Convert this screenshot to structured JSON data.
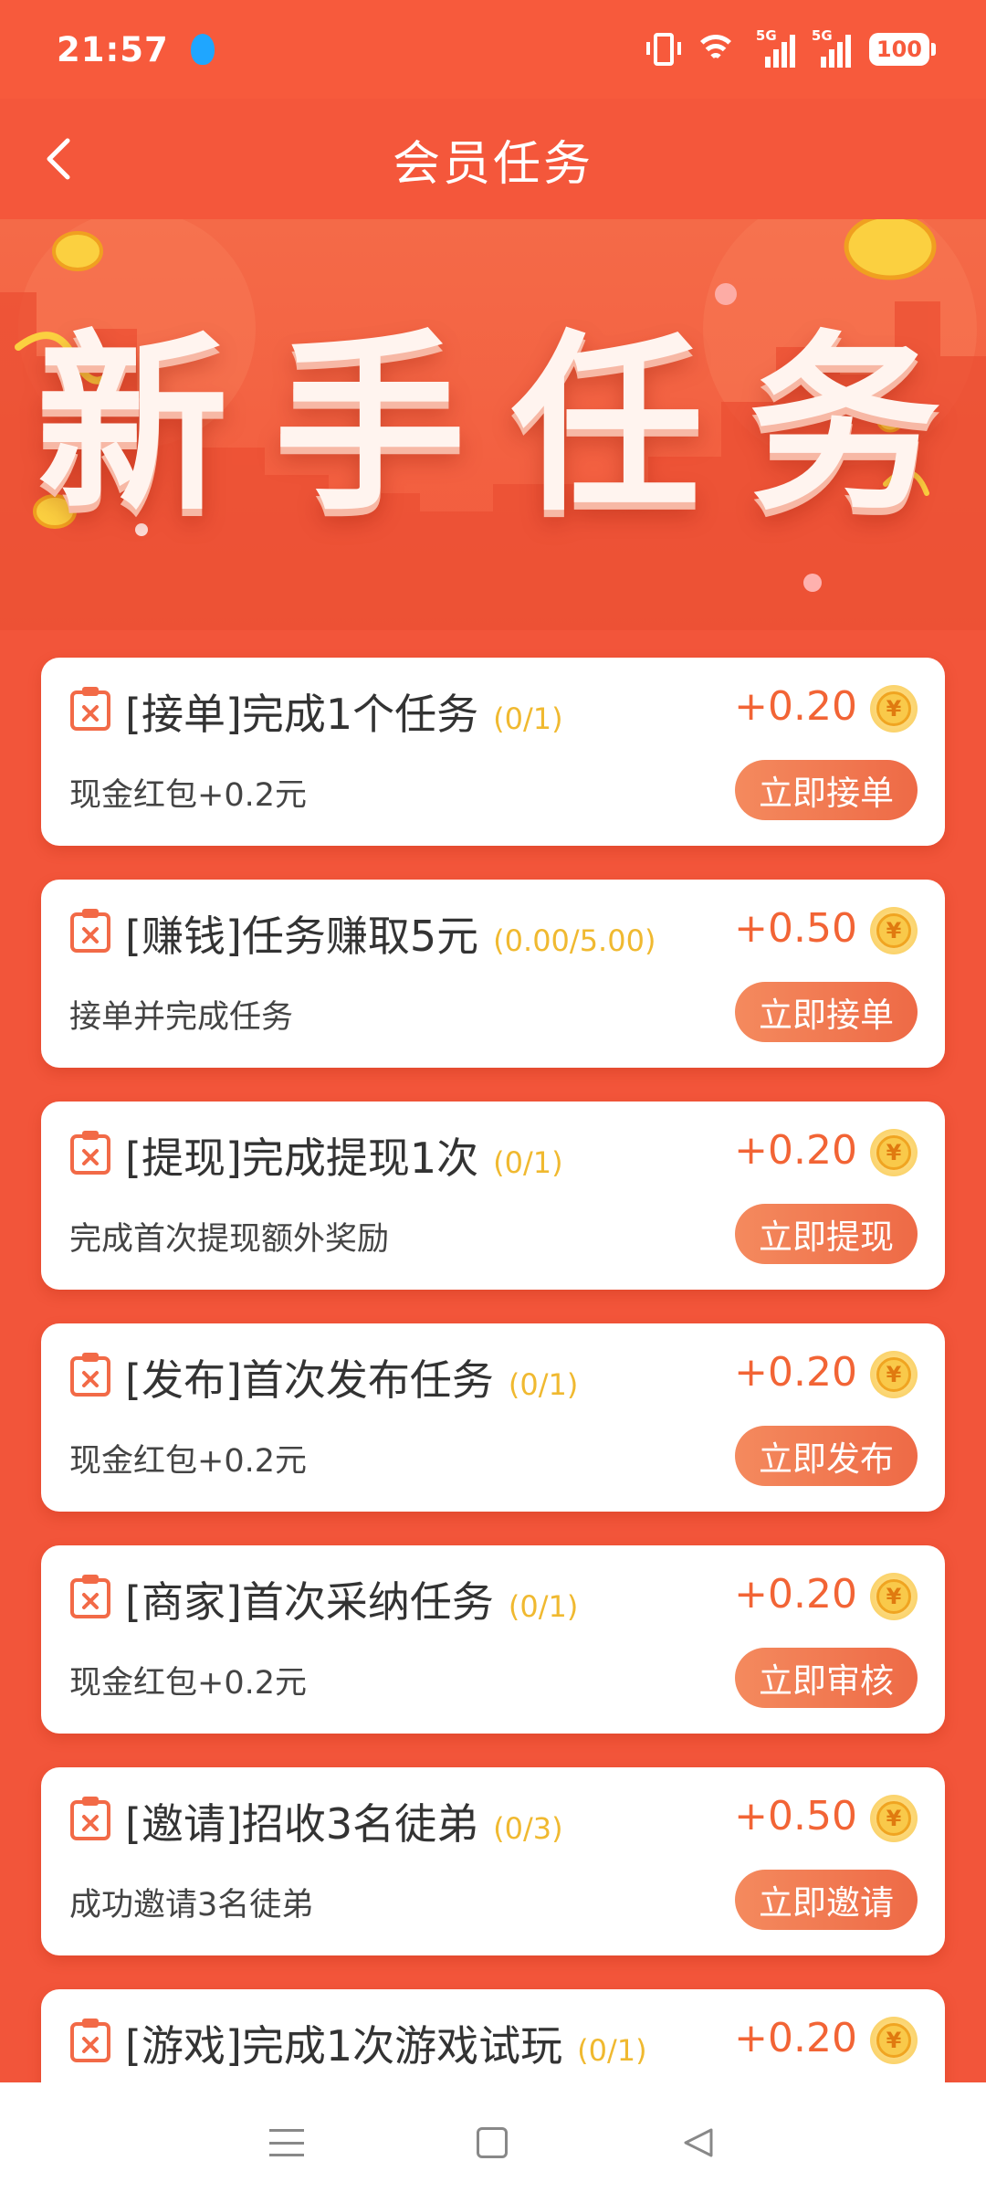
{
  "status_bar": {
    "time": "21:57",
    "network_1": "5G",
    "network_2": "5G",
    "battery": "100"
  },
  "header": {
    "title": "会员任务"
  },
  "banner": {
    "title": "新手任务"
  },
  "tasks": [
    {
      "title": "[接单]完成1个任务",
      "progress": "(0/1)",
      "reward": "+0.20",
      "desc": "现金红包+0.2元",
      "button": "立即接单"
    },
    {
      "title": "[赚钱]任务赚取5元",
      "progress": "(0.00/5.00)",
      "reward": "+0.50",
      "desc": "接单并完成任务",
      "button": "立即接单"
    },
    {
      "title": "[提现]完成提现1次",
      "progress": "(0/1)",
      "reward": "+0.20",
      "desc": "完成首次提现额外奖励",
      "button": "立即提现"
    },
    {
      "title": "[发布]首次发布任务",
      "progress": "(0/1)",
      "reward": "+0.20",
      "desc": "现金红包+0.2元",
      "button": "立即发布"
    },
    {
      "title": "[商家]首次采纳任务",
      "progress": "(0/1)",
      "reward": "+0.20",
      "desc": "现金红包+0.2元",
      "button": "立即审核"
    },
    {
      "title": "[邀请]招收3名徒弟",
      "progress": "(0/3)",
      "reward": "+0.50",
      "desc": "成功邀请3名徒弟",
      "button": "立即邀请"
    },
    {
      "title": "[游戏]完成1次游戏试玩",
      "progress": "(0/1)",
      "reward": "+0.20"
    }
  ],
  "coin_symbol": "¥",
  "colors": {
    "accent": "#f4573b",
    "reward": "#f26435",
    "progress": "#f0b930",
    "button": "#ee6a46"
  }
}
